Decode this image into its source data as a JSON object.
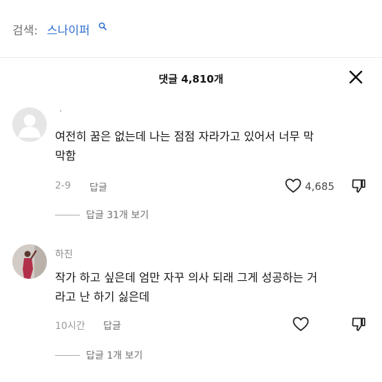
{
  "search": {
    "prefix": "검색:",
    "query": "스나이퍼"
  },
  "sheet": {
    "title": "댓글 4,810개"
  },
  "comments": [
    {
      "username": ".",
      "lines": [
        "여전히 꿈은 없는데 나는 점점 자라가고 있어서 너무 막",
        "막함"
      ],
      "time": "2-9",
      "reply_label": "답글",
      "like_count": "4,685",
      "view_replies": "답글 31개 보기"
    },
    {
      "username": "하진",
      "lines": [
        "작가 하고 싶은데 엄만 자꾸 의사 되래 그게 성공하는 거",
        "라고 난 하기 싫은데"
      ],
      "time": "10시간",
      "reply_label": "답글",
      "like_count": "",
      "view_replies": "답글 1개 보기"
    }
  ],
  "colors": {
    "accent": "#2f6fd0",
    "text": "#161616",
    "muted": "#8a8a8a"
  },
  "icons": [
    "search-icon",
    "close-icon",
    "heart-icon",
    "dislike-icon",
    "default-avatar-icon"
  ]
}
